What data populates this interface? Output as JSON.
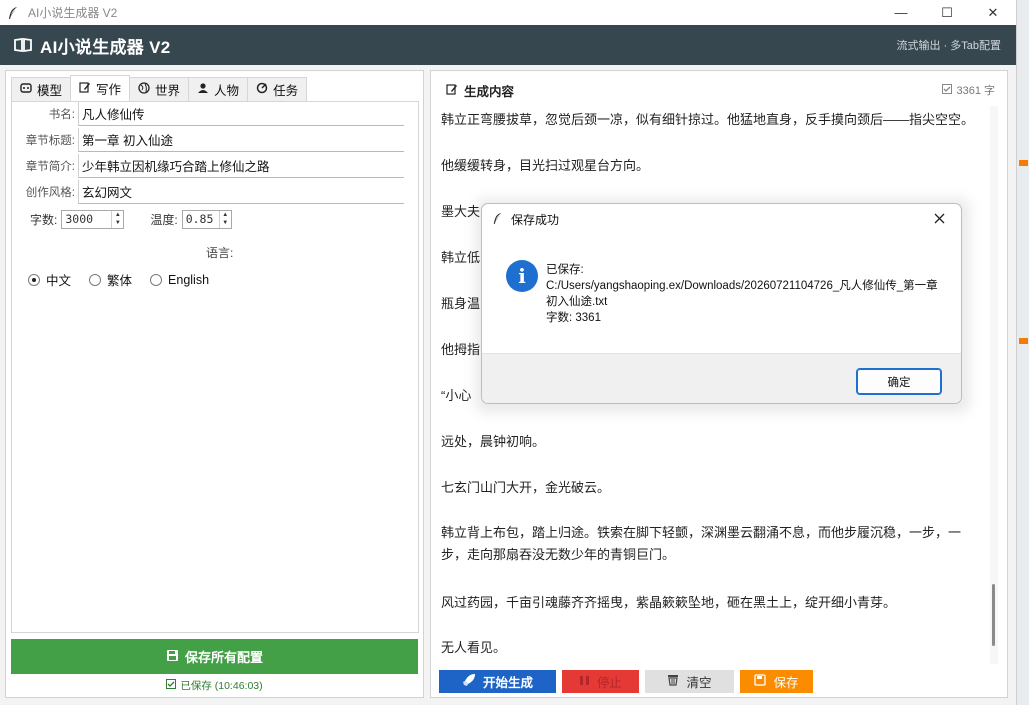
{
  "window": {
    "title": "AI小说生成器 V2",
    "controls": {
      "minimize": "—",
      "maximize": "☐",
      "close": "✕"
    }
  },
  "header": {
    "title": "AI小说生成器 V2",
    "subtitle": "流式输出 · 多Tab配置"
  },
  "tabs": [
    {
      "label": "模型",
      "icon": "model-icon"
    },
    {
      "label": "写作",
      "icon": "edit-icon",
      "active": true
    },
    {
      "label": "世界",
      "icon": "globe-icon"
    },
    {
      "label": "人物",
      "icon": "person-icon"
    },
    {
      "label": "任务",
      "icon": "task-icon"
    }
  ],
  "form": {
    "book_name": {
      "label": "书名:",
      "value": "凡人修仙传"
    },
    "chapter_title": {
      "label": "章节标题:",
      "value": "第一章 初入仙途"
    },
    "chapter_summary": {
      "label": "章节简介:",
      "value": "少年韩立因机缘巧合踏上修仙之路"
    },
    "style": {
      "label": "创作风格:",
      "value": "玄幻网文"
    },
    "word_count": {
      "label": "字数:",
      "value": "3000"
    },
    "temperature": {
      "label": "温度:",
      "value": "0.85"
    },
    "language": {
      "label": "语言:",
      "options": [
        "中文",
        "繁体",
        "English"
      ],
      "selected": "中文"
    }
  },
  "save_all": {
    "label": "保存所有配置"
  },
  "saved_status": "已保存 (10:46:03)",
  "output": {
    "title": "生成内容",
    "count": "3361 字",
    "paragraphs": [
      "韩立正弯腰拔草，忽觉后颈一凉，似有细针掠过。他猛地直身，反手摸向颈后——指尖空空。",
      "他缓缓转身，目光扫过观星台方向。",
      "墨大夫",
      "韩立低",
      "瓶身温",
      "他拇指",
      "“小心",
      "远处，晨钟初响。",
      "七玄门山门大开，金光破云。",
      "韩立背上布包，踏上归途。铁索在脚下轻颤，深渊墨云翻涌不息，而他步履沉稳，一步，一步，走向那扇吞没无数少年的青铜巨门。",
      "风过药园，千亩引魂藤齐齐摇曳，紫晶簌簌坠地，砸在黑土上，绽开细小青芽。",
      "无人看见。"
    ]
  },
  "buttons": {
    "start": "开始生成",
    "stop": "停止",
    "clear": "清空",
    "save": "保存"
  },
  "dialog": {
    "title": "保存成功",
    "line1": "已保存:",
    "path": "C:/Users/yangshaoping.ex/Downloads/20260721104726_凡人修仙传_第一章初入仙途.txt",
    "count": "字数: 3361",
    "ok": "确定"
  },
  "colors": {
    "header_bg": "#37474f",
    "save_all_bg": "#43a047",
    "start_bg": "#1e63c6",
    "stop_bg": "#e53935",
    "clear_bg": "#e0e0e0",
    "save_bg": "#fb8c00",
    "info_blue": "#1e6fd0"
  }
}
